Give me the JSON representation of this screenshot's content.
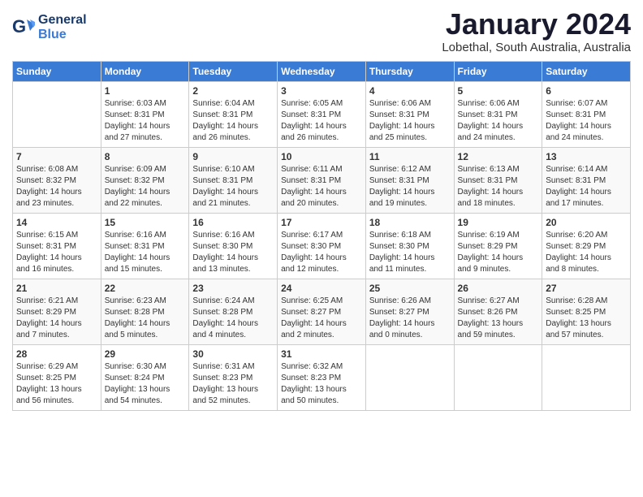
{
  "header": {
    "logo_line1": "General",
    "logo_line2": "Blue",
    "month": "January 2024",
    "location": "Lobethal, South Australia, Australia"
  },
  "days_of_week": [
    "Sunday",
    "Monday",
    "Tuesday",
    "Wednesday",
    "Thursday",
    "Friday",
    "Saturday"
  ],
  "weeks": [
    [
      {
        "day": "",
        "info": ""
      },
      {
        "day": "1",
        "info": "Sunrise: 6:03 AM\nSunset: 8:31 PM\nDaylight: 14 hours\nand 27 minutes."
      },
      {
        "day": "2",
        "info": "Sunrise: 6:04 AM\nSunset: 8:31 PM\nDaylight: 14 hours\nand 26 minutes."
      },
      {
        "day": "3",
        "info": "Sunrise: 6:05 AM\nSunset: 8:31 PM\nDaylight: 14 hours\nand 26 minutes."
      },
      {
        "day": "4",
        "info": "Sunrise: 6:06 AM\nSunset: 8:31 PM\nDaylight: 14 hours\nand 25 minutes."
      },
      {
        "day": "5",
        "info": "Sunrise: 6:06 AM\nSunset: 8:31 PM\nDaylight: 14 hours\nand 24 minutes."
      },
      {
        "day": "6",
        "info": "Sunrise: 6:07 AM\nSunset: 8:31 PM\nDaylight: 14 hours\nand 24 minutes."
      }
    ],
    [
      {
        "day": "7",
        "info": "Sunrise: 6:08 AM\nSunset: 8:32 PM\nDaylight: 14 hours\nand 23 minutes."
      },
      {
        "day": "8",
        "info": "Sunrise: 6:09 AM\nSunset: 8:32 PM\nDaylight: 14 hours\nand 22 minutes."
      },
      {
        "day": "9",
        "info": "Sunrise: 6:10 AM\nSunset: 8:31 PM\nDaylight: 14 hours\nand 21 minutes."
      },
      {
        "day": "10",
        "info": "Sunrise: 6:11 AM\nSunset: 8:31 PM\nDaylight: 14 hours\nand 20 minutes."
      },
      {
        "day": "11",
        "info": "Sunrise: 6:12 AM\nSunset: 8:31 PM\nDaylight: 14 hours\nand 19 minutes."
      },
      {
        "day": "12",
        "info": "Sunrise: 6:13 AM\nSunset: 8:31 PM\nDaylight: 14 hours\nand 18 minutes."
      },
      {
        "day": "13",
        "info": "Sunrise: 6:14 AM\nSunset: 8:31 PM\nDaylight: 14 hours\nand 17 minutes."
      }
    ],
    [
      {
        "day": "14",
        "info": "Sunrise: 6:15 AM\nSunset: 8:31 PM\nDaylight: 14 hours\nand 16 minutes."
      },
      {
        "day": "15",
        "info": "Sunrise: 6:16 AM\nSunset: 8:31 PM\nDaylight: 14 hours\nand 15 minutes."
      },
      {
        "day": "16",
        "info": "Sunrise: 6:16 AM\nSunset: 8:30 PM\nDaylight: 14 hours\nand 13 minutes."
      },
      {
        "day": "17",
        "info": "Sunrise: 6:17 AM\nSunset: 8:30 PM\nDaylight: 14 hours\nand 12 minutes."
      },
      {
        "day": "18",
        "info": "Sunrise: 6:18 AM\nSunset: 8:30 PM\nDaylight: 14 hours\nand 11 minutes."
      },
      {
        "day": "19",
        "info": "Sunrise: 6:19 AM\nSunset: 8:29 PM\nDaylight: 14 hours\nand 9 minutes."
      },
      {
        "day": "20",
        "info": "Sunrise: 6:20 AM\nSunset: 8:29 PM\nDaylight: 14 hours\nand 8 minutes."
      }
    ],
    [
      {
        "day": "21",
        "info": "Sunrise: 6:21 AM\nSunset: 8:29 PM\nDaylight: 14 hours\nand 7 minutes."
      },
      {
        "day": "22",
        "info": "Sunrise: 6:23 AM\nSunset: 8:28 PM\nDaylight: 14 hours\nand 5 minutes."
      },
      {
        "day": "23",
        "info": "Sunrise: 6:24 AM\nSunset: 8:28 PM\nDaylight: 14 hours\nand 4 minutes."
      },
      {
        "day": "24",
        "info": "Sunrise: 6:25 AM\nSunset: 8:27 PM\nDaylight: 14 hours\nand 2 minutes."
      },
      {
        "day": "25",
        "info": "Sunrise: 6:26 AM\nSunset: 8:27 PM\nDaylight: 14 hours\nand 0 minutes."
      },
      {
        "day": "26",
        "info": "Sunrise: 6:27 AM\nSunset: 8:26 PM\nDaylight: 13 hours\nand 59 minutes."
      },
      {
        "day": "27",
        "info": "Sunrise: 6:28 AM\nSunset: 8:25 PM\nDaylight: 13 hours\nand 57 minutes."
      }
    ],
    [
      {
        "day": "28",
        "info": "Sunrise: 6:29 AM\nSunset: 8:25 PM\nDaylight: 13 hours\nand 56 minutes."
      },
      {
        "day": "29",
        "info": "Sunrise: 6:30 AM\nSunset: 8:24 PM\nDaylight: 13 hours\nand 54 minutes."
      },
      {
        "day": "30",
        "info": "Sunrise: 6:31 AM\nSunset: 8:23 PM\nDaylight: 13 hours\nand 52 minutes."
      },
      {
        "day": "31",
        "info": "Sunrise: 6:32 AM\nSunset: 8:23 PM\nDaylight: 13 hours\nand 50 minutes."
      },
      {
        "day": "",
        "info": ""
      },
      {
        "day": "",
        "info": ""
      },
      {
        "day": "",
        "info": ""
      }
    ]
  ]
}
